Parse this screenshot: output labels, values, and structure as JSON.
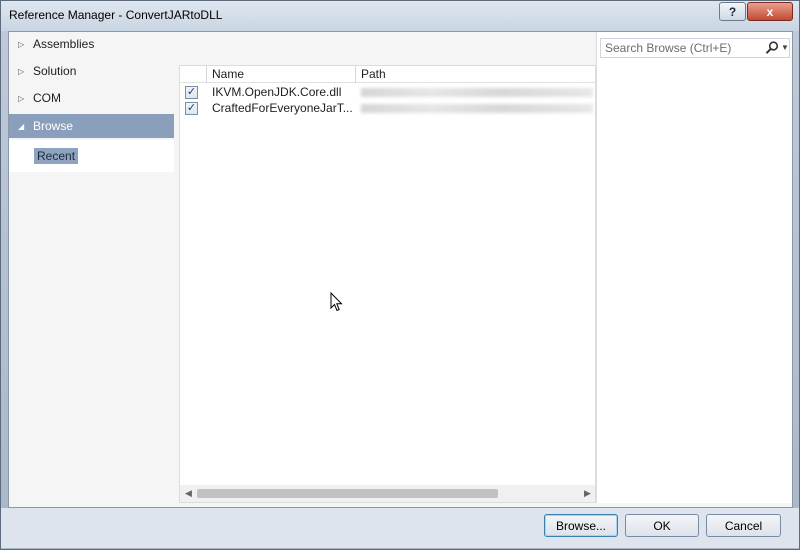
{
  "window": {
    "title": "Reference Manager - ConvertJARtoDLL",
    "help_label": "?",
    "close_label": "x"
  },
  "nav": {
    "items": [
      {
        "label": "Assemblies",
        "expanded": false
      },
      {
        "label": "Solution",
        "expanded": false
      },
      {
        "label": "COM",
        "expanded": false
      },
      {
        "label": "Browse",
        "expanded": true,
        "selected": true
      }
    ],
    "sub_items": [
      {
        "label": "Recent",
        "selected": true
      }
    ]
  },
  "search": {
    "placeholder": "Search Browse (Ctrl+E)",
    "value": ""
  },
  "table": {
    "columns": [
      "Name",
      "Path"
    ],
    "rows": [
      {
        "checked": true,
        "name": "IKVM.OpenJDK.Core.dll",
        "path": "[blurred path]"
      },
      {
        "checked": true,
        "name": "CraftedForEveryoneJarT...",
        "path": "[blurred path]"
      }
    ]
  },
  "buttons": {
    "browse": "Browse...",
    "ok": "OK",
    "cancel": "Cancel"
  },
  "colors": {
    "selection": "#8a9fbc",
    "frame": "#bfcbd9"
  }
}
